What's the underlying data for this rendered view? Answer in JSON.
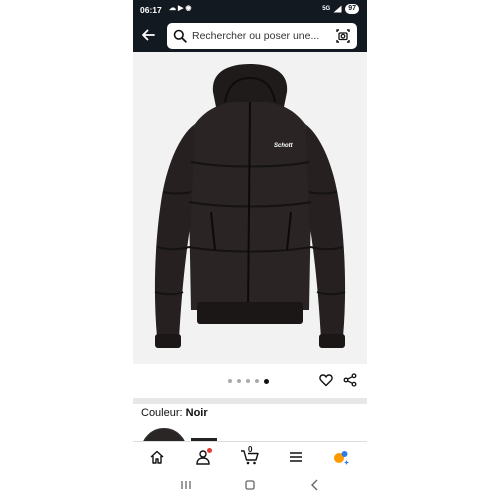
{
  "status_bar": {
    "time": "06:17",
    "network": "5G",
    "battery": "97"
  },
  "search": {
    "placeholder": "Rechercher ou poser une..."
  },
  "product": {
    "brand_mark": "Schott",
    "image_count": 5,
    "active_image_index": 4
  },
  "color": {
    "label": "Couleur: ",
    "value": "Noir"
  },
  "bottom_nav": {
    "cart_count": "0",
    "items": [
      "home",
      "account",
      "cart",
      "menu",
      "rufus"
    ]
  },
  "colors": {
    "header_bg": "#131921",
    "accent_orange": "#ff9900",
    "badge_red": "#e53935"
  }
}
